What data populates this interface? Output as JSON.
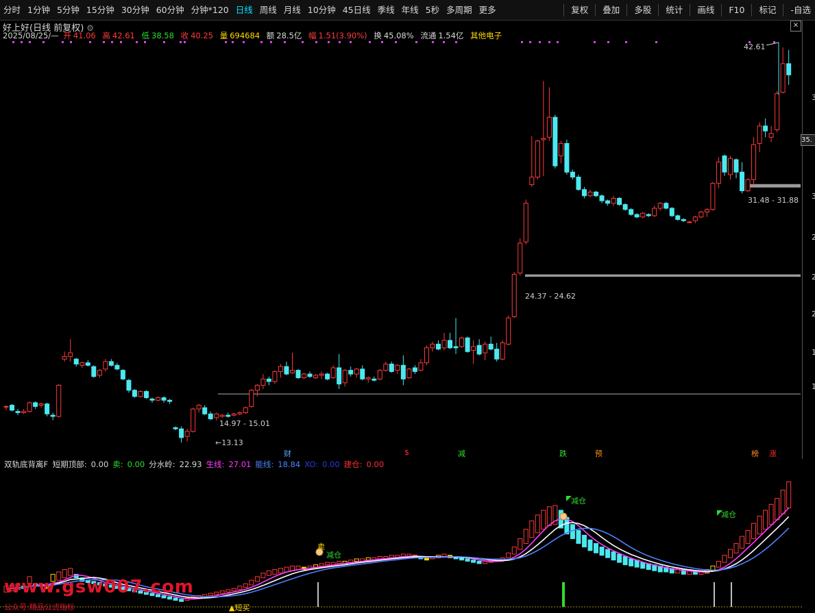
{
  "toolbar": {
    "tabs": [
      "分时",
      "1分钟",
      "5分钟",
      "15分钟",
      "30分钟",
      "60分钟",
      "分钟*120",
      "日线",
      "周线",
      "月线",
      "10分钟",
      "45日线",
      "季线",
      "年线",
      "5秒",
      "多周期",
      "更多"
    ],
    "active_tab": "日线",
    "right_buttons": [
      "复权",
      "叠加",
      "多股",
      "统计",
      "画线",
      "F10",
      "标记",
      "-自选"
    ]
  },
  "stock": {
    "name": "好上好",
    "period": "(日线 前复权)"
  },
  "info": {
    "date": "2025/08/25/—",
    "open_label": "开",
    "open": "41.06",
    "high_label": "高",
    "high": "42.61",
    "low_label": "低",
    "low": "38.58",
    "close_label": "收",
    "close": "40.25",
    "vol_label": "量",
    "vol": "694684",
    "amt_label": "额",
    "amt": "28.5亿",
    "chg_label": "幅",
    "chg": "1.51(3.90%)",
    "turn_label": "换",
    "turn": "45.08%",
    "float_label": "流通",
    "float": "1.54亿",
    "sector": "其他电子"
  },
  "price_axis": {
    "current": "35.",
    "ticks": [
      "3",
      "3",
      "2",
      "2",
      "2",
      "1",
      "1"
    ]
  },
  "annotations": {
    "high_mark": "42.61",
    "low_mark": "←13.13",
    "range1": "14.97 - 15.01",
    "range2": "24.37 - 24.62",
    "range3": "31.48 - 31.88"
  },
  "events": [
    {
      "text": "财",
      "color": "#57a8ff"
    },
    {
      "text": "$",
      "color": "#ff3030"
    },
    {
      "text": "减",
      "color": "#2fdc2f"
    },
    {
      "text": "跌",
      "color": "#2fdc2f"
    },
    {
      "text": "预",
      "color": "#ff8c1a"
    },
    {
      "text": "榜",
      "color": "#ff8c1a"
    },
    {
      "text": "涨",
      "color": "#ff3030"
    }
  ],
  "indicator": {
    "name": "双轨底背离F",
    "items": [
      {
        "label": "短期顶部:",
        "value": "0.00",
        "color": "#d8d8d8"
      },
      {
        "label": "卖:",
        "value": "0.00",
        "color": "#2fdc2f"
      },
      {
        "label": "分水岭:",
        "value": "22.93",
        "color": "#d8d8d8"
      },
      {
        "label": "生线:",
        "value": "27.01",
        "color": "#ff3cff"
      },
      {
        "label": "能线:",
        "value": "18.84",
        "color": "#4f82ff"
      },
      {
        "label": "XO:",
        "value": "0.00",
        "color": "#2f39d8"
      },
      {
        "label": "建仓:",
        "value": "0.00",
        "color": "#ff3030"
      }
    ],
    "signals": {
      "sell": "卖",
      "reduce": "减仓",
      "short_buy": "▲短买"
    }
  },
  "watermark": "www.gsw007.com",
  "subnote": "公众号:精品公式指标",
  "chart_data": {
    "type": "candlestick",
    "candles": [
      [
        14,
        14.1,
        13.7,
        14
      ],
      [
        14.1,
        14.2,
        13.6,
        13.7
      ],
      [
        13.6,
        13.8,
        13.3,
        13.5
      ],
      [
        13.5,
        13.8,
        13.4,
        13.6
      ],
      [
        13.6,
        14.4,
        13.5,
        14.3
      ],
      [
        14.3,
        14.4,
        13.8,
        14
      ],
      [
        14.1,
        14.3,
        13.9,
        14.2
      ],
      [
        14.2,
        14.3,
        13.2,
        13.4
      ],
      [
        13.3,
        13.5,
        12.9,
        13.2
      ],
      [
        13.2,
        15.8,
        13.1,
        15.7
      ],
      [
        17.8,
        18.4,
        17.6,
        18
      ],
      [
        18,
        19.4,
        17.6,
        18.3
      ],
      [
        17.8,
        17.9,
        17.2,
        17.4
      ],
      [
        17.3,
        17.6,
        17.1,
        17.5
      ],
      [
        17.5,
        17.7,
        17.2,
        17.3
      ],
      [
        17.2,
        17.3,
        16.3,
        16.4
      ],
      [
        16.5,
        17,
        16.3,
        16.9
      ],
      [
        17,
        17.8,
        16.8,
        17.6
      ],
      [
        17.6,
        17.8,
        17.2,
        17.3
      ],
      [
        17.3,
        17.5,
        16.9,
        17
      ],
      [
        16.9,
        17,
        16.1,
        16.2
      ],
      [
        16.1,
        16.2,
        15.1,
        15.3
      ],
      [
        15.3,
        15.4,
        14.7,
        14.8
      ],
      [
        14.8,
        15.3,
        14.7,
        15.2
      ],
      [
        15.2,
        15.3,
        14.6,
        14.7
      ],
      [
        14.6,
        14.7,
        14.3,
        14.5
      ],
      [
        14.5,
        14.8,
        14.4,
        14.7
      ],
      [
        14.7,
        14.8,
        14.3,
        14.5
      ],
      [
        14.5,
        14.6,
        14.2,
        14.4
      ],
      [
        12.3,
        12.4,
        12.1,
        12.2
      ],
      [
        12.2,
        12.4,
        11.1,
        11.5
      ],
      [
        11.6,
        12.2,
        11.2,
        12
      ],
      [
        12,
        13.9,
        11.9,
        13.8
      ],
      [
        13.8,
        14.2,
        13.5,
        14.1
      ],
      [
        13.9,
        14.1,
        13.3,
        13.4
      ],
      [
        13.4,
        13.6,
        12.9,
        13
      ],
      [
        13.1,
        13.5,
        12.9,
        13.4
      ],
      [
        13.2,
        13.4,
        13.1,
        13.3
      ],
      [
        13.3,
        13.5,
        13.1,
        13.2
      ],
      [
        13.3,
        13.5,
        13.2,
        13.4
      ],
      [
        13.4,
        13.6,
        13.3,
        13.5
      ],
      [
        13.5,
        14,
        13.4,
        13.9
      ],
      [
        14,
        15.4,
        13.9,
        15.3
      ],
      [
        15.3,
        15.8,
        14.8,
        15.7
      ],
      [
        15.7,
        16.6,
        15.4,
        16.2
      ],
      [
        16.2,
        16.4,
        15.7,
        16
      ],
      [
        16,
        16.9,
        15.8,
        16.8
      ],
      [
        16.8,
        17.4,
        16.3,
        17.2
      ],
      [
        17.2,
        17.6,
        16.5,
        16.6
      ],
      [
        16.7,
        18.3,
        16.6,
        16.9
      ],
      [
        16.9,
        17,
        16.2,
        16.3
      ],
      [
        16.3,
        16.7,
        16.2,
        16.6
      ],
      [
        16.6,
        16.8,
        16.3,
        16.4
      ],
      [
        16.3,
        16.6,
        16.2,
        16.5
      ],
      [
        16.5,
        16.8,
        16.2,
        16.6
      ],
      [
        16.6,
        16.7,
        16.1,
        16.2
      ],
      [
        16.3,
        17.3,
        16.2,
        17.1
      ],
      [
        17.1,
        18.2,
        15.4,
        15.8
      ],
      [
        15.9,
        17,
        15.6,
        16.9
      ],
      [
        16.9,
        17.2,
        16.4,
        16.6
      ],
      [
        16.6,
        17.1,
        16.3,
        17
      ],
      [
        17,
        17.3,
        16.1,
        16.2
      ],
      [
        16.2,
        16.4,
        15.9,
        16.3
      ],
      [
        16.2,
        16.4,
        16,
        16.1
      ],
      [
        16.2,
        17,
        16.1,
        16.9
      ],
      [
        16.9,
        17.6,
        16.8,
        17.4
      ],
      [
        17.4,
        17.6,
        16.7,
        16.8
      ],
      [
        16.9,
        17.4,
        16.6,
        17.3
      ],
      [
        17.3,
        18.1,
        15.7,
        16.2
      ],
      [
        16.3,
        17.1,
        16.2,
        17
      ],
      [
        17.1,
        17.3,
        16.6,
        16.8
      ],
      [
        16.9,
        17.8,
        16.8,
        17.5
      ],
      [
        17.5,
        18.9,
        17.3,
        18.7
      ],
      [
        18.7,
        19.2,
        18.4,
        19
      ],
      [
        19,
        19.3,
        18.5,
        18.6
      ],
      [
        18.7,
        19.9,
        18.5,
        19.3
      ],
      [
        19.3,
        19.9,
        18.6,
        18.7
      ],
      [
        18.8,
        21.1,
        18.2,
        18.7
      ],
      [
        18.8,
        19.6,
        18.7,
        19.5
      ],
      [
        19.5,
        19.6,
        18.3,
        18.4
      ],
      [
        18.5,
        19.3,
        17.4,
        18.8
      ],
      [
        18.9,
        19.4,
        18.1,
        18.2
      ],
      [
        18.3,
        19.2,
        17.7,
        19
      ],
      [
        19,
        19.6,
        18.5,
        18.6
      ],
      [
        18.6,
        19.1,
        17.6,
        17.8
      ],
      [
        17.8,
        19.3,
        17.7,
        19.1
      ],
      [
        19,
        21.3,
        18.9,
        21.1
      ],
      [
        21.2,
        24.8,
        21.1,
        24.6
      ],
      [
        24.7,
        27.5,
        24.5,
        27.1
      ],
      [
        27.2,
        30.6,
        27,
        30.3
      ],
      [
        31.8,
        35.7,
        31.6,
        32.4
      ],
      [
        32.4,
        35.4,
        32.2,
        35.3
      ],
      [
        35.4,
        40.1,
        32.5,
        35.5
      ],
      [
        35.6,
        39.6,
        35.3,
        37.2
      ],
      [
        37.2,
        37.4,
        33.1,
        33.3
      ],
      [
        34.1,
        35.3,
        33.5,
        35.1
      ],
      [
        35.1,
        35.4,
        32.6,
        32.8
      ],
      [
        32.8,
        33,
        32.2,
        32.4
      ],
      [
        32.4,
        32.6,
        31.3,
        31.4
      ],
      [
        31.4,
        31.6,
        30.7,
        30.9
      ],
      [
        30.9,
        31.4,
        30.8,
        31.2
      ],
      [
        31.2,
        31.3,
        30.8,
        30.9
      ],
      [
        30.9,
        31,
        30.3,
        30.5
      ],
      [
        30.5,
        30.6,
        30.1,
        30.3
      ],
      [
        30.3,
        30.9,
        30.1,
        30.7
      ],
      [
        30.7,
        30.8,
        30.1,
        30.2
      ],
      [
        30.2,
        30.3,
        29.7,
        29.8
      ],
      [
        29.8,
        29.9,
        29.3,
        29.4
      ],
      [
        29.4,
        29.5,
        29.1,
        29.2
      ],
      [
        29.2,
        29.6,
        29.1,
        29.5
      ],
      [
        29.4,
        29.5,
        29.2,
        29.3
      ],
      [
        29.3,
        30.1,
        29.2,
        29.9
      ],
      [
        29.9,
        30.4,
        29.7,
        30.3
      ],
      [
        30.3,
        30.4,
        29.8,
        29.9
      ],
      [
        29.9,
        30,
        29.2,
        29.3
      ],
      [
        29.3,
        29.4,
        28.9,
        29
      ],
      [
        29,
        29.1,
        28.8,
        28.9
      ],
      [
        28.8,
        28.9,
        28.7,
        28.8
      ],
      [
        28.9,
        29.3,
        28.7,
        29.2
      ],
      [
        29.2,
        29.7,
        29.1,
        29.6
      ],
      [
        29.6,
        29.9,
        29.2,
        29.8
      ],
      [
        29.8,
        32,
        29.7,
        31.9
      ],
      [
        31.9,
        34,
        31.5,
        33.6
      ],
      [
        34.1,
        34.2,
        32.5,
        32.8
      ],
      [
        32.6,
        34.1,
        32.2,
        33.9
      ],
      [
        33.8,
        33.9,
        32.3,
        32.8
      ],
      [
        32.8,
        33.6,
        31.1,
        31.3
      ],
      [
        31.3,
        32.3,
        31.2,
        32.2
      ],
      [
        32.2,
        35.6,
        31.7,
        35
      ],
      [
        35.1,
        36.8,
        34.4,
        36.5
      ],
      [
        36.5,
        37.1,
        35.6,
        36.1
      ],
      [
        35.6,
        36.5,
        35.2,
        35.9
      ],
      [
        36.2,
        39.3,
        36,
        39.1
      ],
      [
        39.2,
        42.8,
        39.1,
        41.5
      ],
      [
        41.5,
        42.6,
        39.8,
        40.6
      ]
    ],
    "ind_bars": [
      [
        0.3,
        0.8
      ],
      [
        0.4,
        0.9
      ],
      [
        0.5,
        1
      ],
      [
        0.6,
        0.8
      ],
      [
        1.0,
        1.6
      ],
      [
        0.8,
        1
      ],
      [
        0.9,
        1
      ],
      [
        0.6,
        0.8
      ],
      [
        1.2,
        1.8
      ],
      [
        1.3,
        2
      ],
      [
        1.5,
        2.2
      ],
      [
        1.7,
        2.3
      ],
      [
        1.5,
        1.8
      ],
      [
        1.2,
        1.5
      ],
      [
        1.1,
        1.3
      ],
      [
        1.0,
        1.2
      ],
      [
        0.9,
        1.1
      ],
      [
        0.8,
        1
      ],
      [
        0.7,
        0.9
      ],
      [
        0.6,
        0.8
      ],
      [
        0.5,
        0.7
      ],
      [
        0.4,
        0.6
      ],
      [
        0.3,
        0.5
      ],
      [
        0.2,
        0.4
      ],
      [
        0.1,
        0.3
      ],
      [
        0,
        0.2
      ],
      [
        -0.1,
        0.1
      ],
      [
        -0.2,
        0
      ],
      [
        -0.3,
        -0.1
      ],
      [
        -0.4,
        -0.2
      ],
      [
        -0.5,
        -0.3
      ],
      [
        -0.4,
        -0.2
      ],
      [
        -0.3,
        -0.1
      ],
      [
        -0.2,
        0
      ],
      [
        -0.1,
        0.1
      ],
      [
        0,
        0.2
      ],
      [
        0.1,
        0.3
      ],
      [
        0.2,
        0.4
      ],
      [
        0.3,
        0.5
      ],
      [
        0.4,
        0.6
      ],
      [
        0.5,
        0.8
      ],
      [
        0.7,
        1
      ],
      [
        0.9,
        1.3
      ],
      [
        1.2,
        1.6
      ],
      [
        1.5,
        1.9
      ],
      [
        1.7,
        2.1
      ],
      [
        1.8,
        2.2
      ],
      [
        1.9,
        2.3
      ],
      [
        2.0,
        2.4
      ],
      [
        2.1,
        2.5
      ],
      [
        2.2,
        2.5
      ],
      [
        2.2,
        2.4
      ],
      [
        2.3,
        2.5
      ],
      [
        2.4,
        2.6
      ],
      [
        2.5,
        2.7
      ],
      [
        2.6,
        2.8
      ],
      [
        2.6,
        2.8
      ],
      [
        2.7,
        2.9
      ],
      [
        2.7,
        2.9
      ],
      [
        2.8,
        3.0
      ],
      [
        2.9,
        3.1
      ],
      [
        2.9,
        3.1
      ],
      [
        3.0,
        3.2
      ],
      [
        3.0,
        3.2
      ],
      [
        3.1,
        3.3
      ],
      [
        3.1,
        3.3
      ],
      [
        3.2,
        3.4
      ],
      [
        3.2,
        3.4
      ],
      [
        3.3,
        3.5
      ],
      [
        3.3,
        3.5
      ],
      [
        3.2,
        3.4
      ],
      [
        3.1,
        3.3
      ],
      [
        3.0,
        3.2
      ],
      [
        3.1,
        3.3
      ],
      [
        3.2,
        3.4
      ],
      [
        3.3,
        3.5
      ],
      [
        3.2,
        3.4
      ],
      [
        3.1,
        3.3
      ],
      [
        3.0,
        3.2
      ],
      [
        2.9,
        3.1
      ],
      [
        2.8,
        3.0
      ],
      [
        2.7,
        2.9
      ],
      [
        2.7,
        2.9
      ],
      [
        2.8,
        3.0
      ],
      [
        2.9,
        3.1
      ],
      [
        3.0,
        3.2
      ],
      [
        3.2,
        3.6
      ],
      [
        3.5,
        4.1
      ],
      [
        3.9,
        4.8
      ],
      [
        4.4,
        5.6
      ],
      [
        4.9,
        6.3
      ],
      [
        5.3,
        6.8
      ],
      [
        5.6,
        7.2
      ],
      [
        5.9,
        7.5
      ],
      [
        6.0,
        7.6
      ],
      [
        5.7,
        7.2
      ],
      [
        5.2,
        6.6
      ],
      [
        4.8,
        6.0
      ],
      [
        4.4,
        5.5
      ],
      [
        4.1,
        5.1
      ],
      [
        3.8,
        4.7
      ],
      [
        3.6,
        4.4
      ],
      [
        3.4,
        4.1
      ],
      [
        3.2,
        3.9
      ],
      [
        3.0,
        3.7
      ],
      [
        2.8,
        3.5
      ],
      [
        2.6,
        3.3
      ],
      [
        2.5,
        3.1
      ],
      [
        2.4,
        3.0
      ],
      [
        2.3,
        2.8
      ],
      [
        2.2,
        2.7
      ],
      [
        2.1,
        2.6
      ],
      [
        2.0,
        2.5
      ],
      [
        2.0,
        2.4
      ],
      [
        1.9,
        2.3
      ],
      [
        1.9,
        2.3
      ],
      [
        1.8,
        2.2
      ],
      [
        1.8,
        2.2
      ],
      [
        1.8,
        2.1
      ],
      [
        1.8,
        2.1
      ],
      [
        1.9,
        2.2
      ],
      [
        2.1,
        2.5
      ],
      [
        2.4,
        2.9
      ],
      [
        2.8,
        3.4
      ],
      [
        3.2,
        3.9
      ],
      [
        3.6,
        4.4
      ],
      [
        4.0,
        5.0
      ],
      [
        4.4,
        5.5
      ],
      [
        4.8,
        6.1
      ],
      [
        5.2,
        6.7
      ],
      [
        5.6,
        7.2
      ],
      [
        6.0,
        7.7
      ],
      [
        6.4,
        8.2
      ],
      [
        6.9,
        8.9
      ],
      [
        7.4,
        9.6
      ]
    ]
  }
}
